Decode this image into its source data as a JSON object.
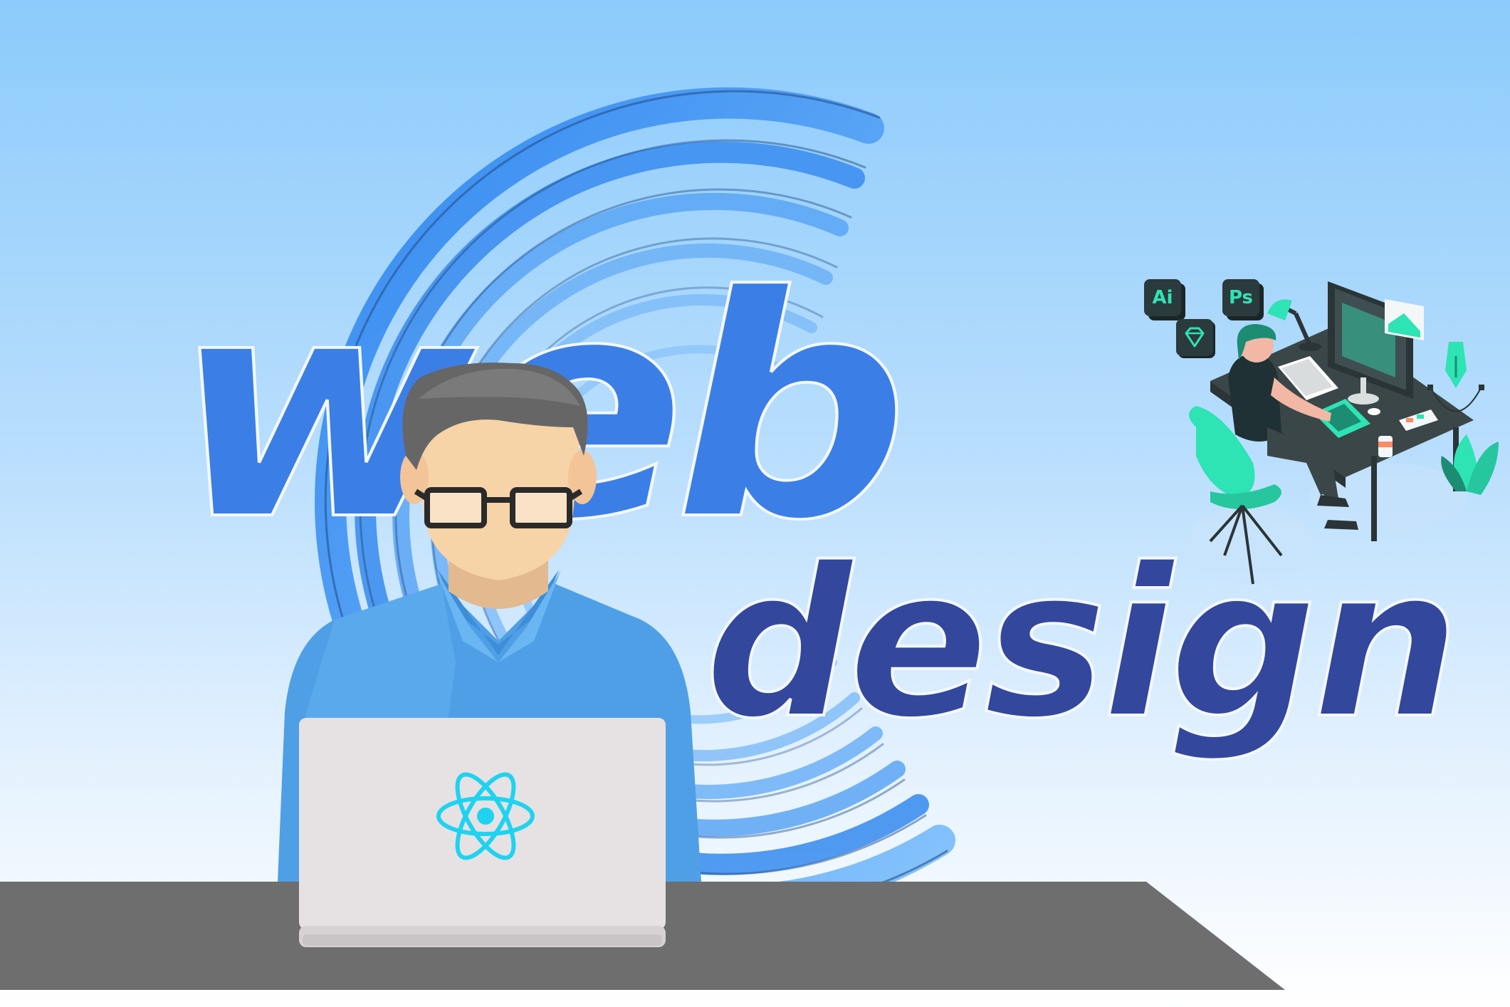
{
  "headline": {
    "line1": "web",
    "line2": "design"
  },
  "app_icons": {
    "illustrator": "Ai",
    "photoshop": "Ps",
    "sketch": "sketch-diamond-icon"
  },
  "laptop_logo": "react-atom-icon",
  "colors": {
    "sky_top": "#8ccbfb",
    "sky_bottom": "#ffffff",
    "web_blue": "#3b7fe6",
    "design_navy": "#33479c",
    "shirt": "#4f9fe6",
    "laptop": "#e6e2e3",
    "react": "#1fd3f0",
    "desk": "#6e6e6e",
    "teal_accent": "#2ee3b4"
  }
}
